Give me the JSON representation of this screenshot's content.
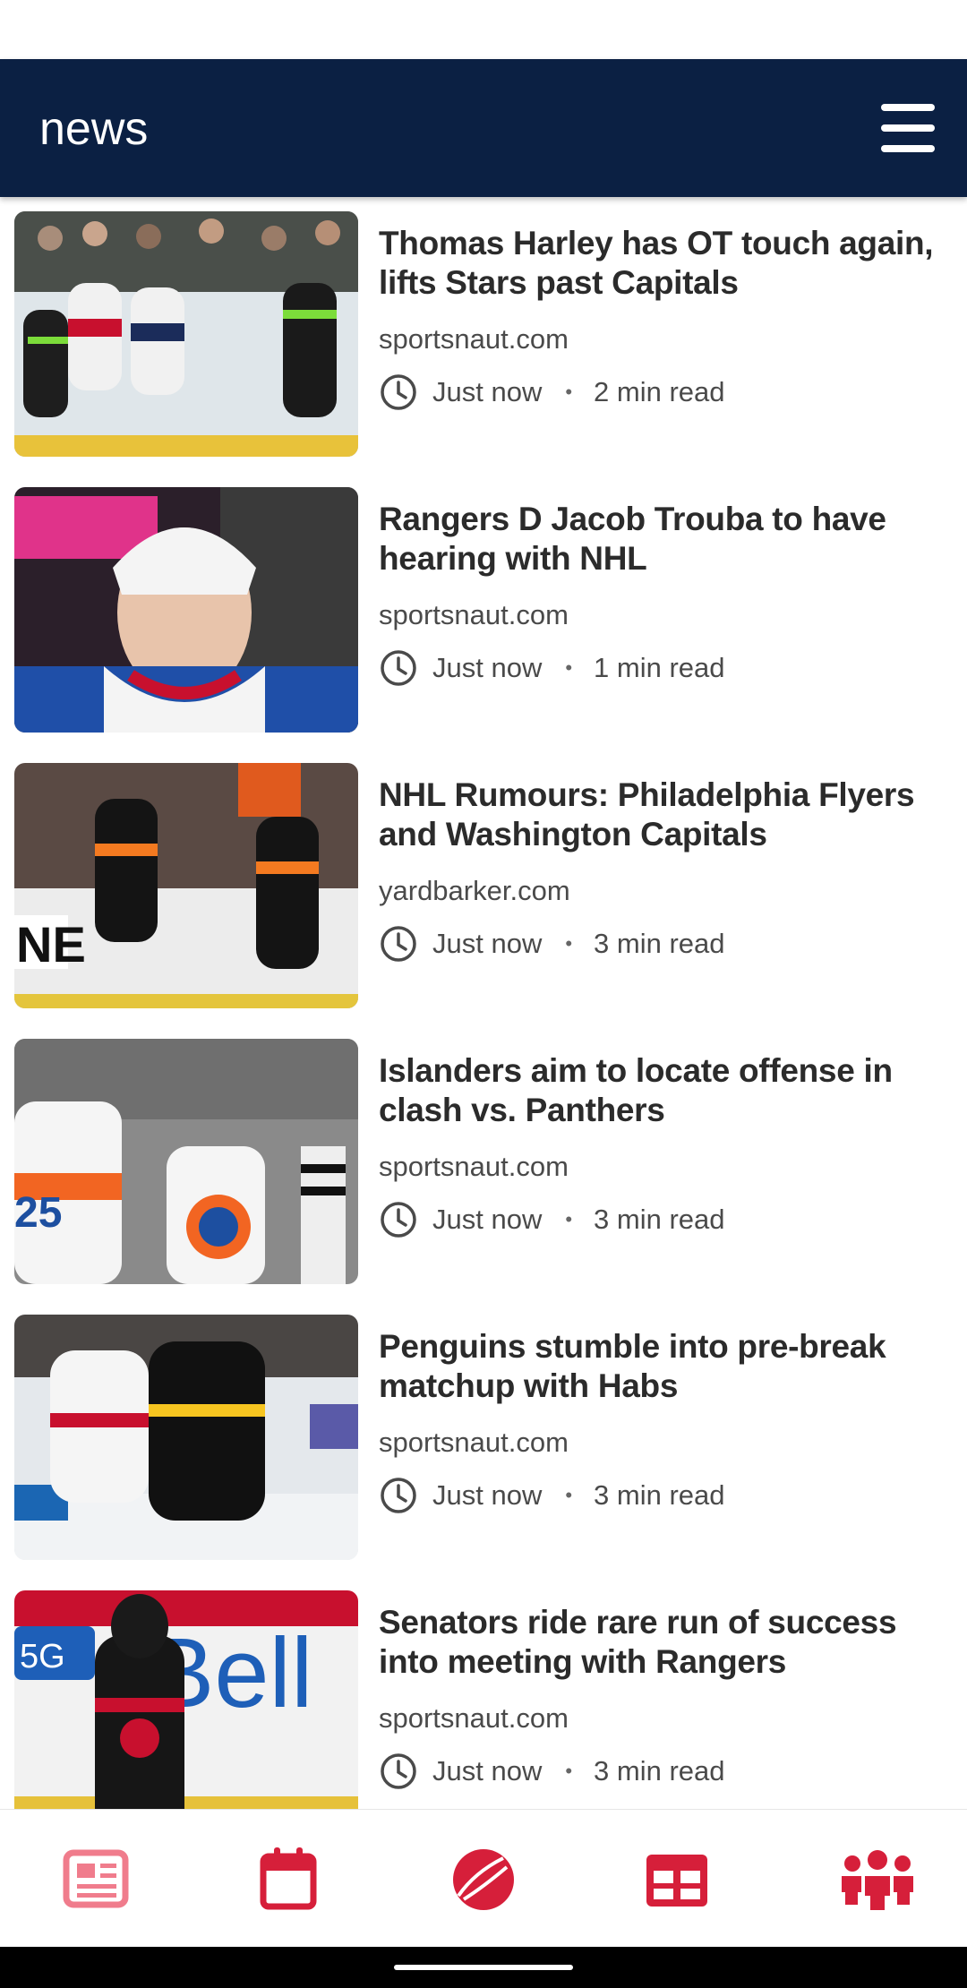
{
  "app_bar": {
    "title": "news",
    "menu_icon": "hamburger-menu-icon"
  },
  "articles": [
    {
      "title": "Thomas Harley has OT touch again, lifts Stars past Capitals",
      "source": "sportsnaut.com",
      "time": "Just now",
      "read_time": "2 min read"
    },
    {
      "title": "Rangers D Jacob Trouba to have hearing with NHL",
      "source": "sportsnaut.com",
      "time": "Just now",
      "read_time": "1 min read"
    },
    {
      "title": "NHL Rumours: Philadelphia Flyers and Washington Capitals",
      "source": "yardbarker.com",
      "time": "Just now",
      "read_time": "3 min read"
    },
    {
      "title": "Islanders aim to locate offense in clash vs. Panthers",
      "source": "sportsnaut.com",
      "time": "Just now",
      "read_time": "3 min read"
    },
    {
      "title": "Penguins stumble into pre-break matchup with Habs",
      "source": "sportsnaut.com",
      "time": "Just now",
      "read_time": "3 min read"
    },
    {
      "title": "Senators ride rare run of success into meeting with Rangers",
      "source": "sportsnaut.com",
      "time": "Just now",
      "read_time": "3 min read"
    }
  ],
  "meta_separator": "•",
  "bottom_nav": {
    "items": [
      {
        "icon": "newspaper-icon",
        "active": true
      },
      {
        "icon": "calendar-icon",
        "active": false
      },
      {
        "icon": "ball-icon",
        "active": false
      },
      {
        "icon": "standings-table-icon",
        "active": false
      },
      {
        "icon": "team-people-icon",
        "active": false
      }
    ]
  },
  "colors": {
    "app_bar_bg": "#0b2043",
    "accent_red": "#d61f3a",
    "inactive_red": "#f07c8c",
    "text_dark": "#2b2b2b",
    "text_secondary": "#4a4a4a"
  }
}
